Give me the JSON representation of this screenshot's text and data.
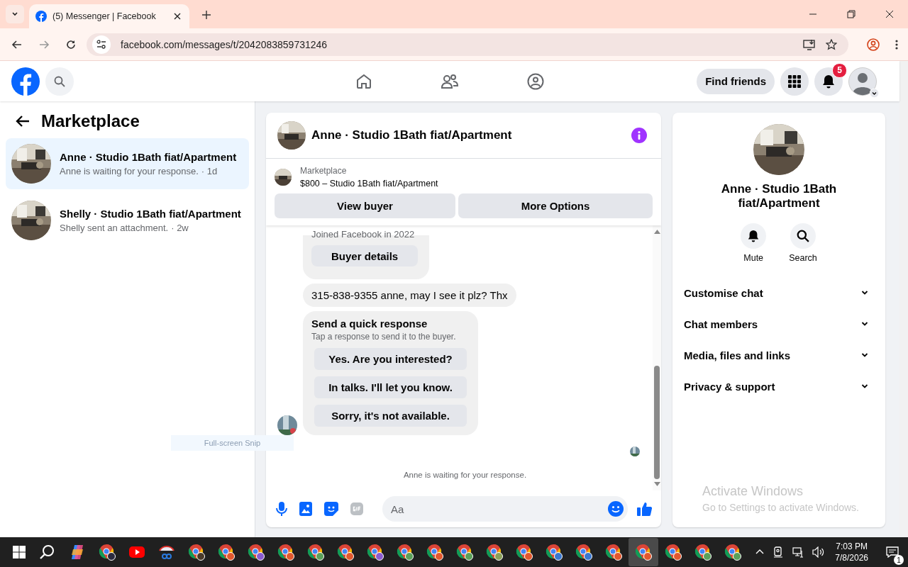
{
  "browser": {
    "tab_title": "(5) Messenger | Facebook",
    "url": "facebook.com/messages/t/2042083859731246"
  },
  "header": {
    "find_friends": "Find friends",
    "notification_count": "5"
  },
  "sidebar": {
    "title": "Marketplace",
    "conversations": [
      {
        "name": "Anne · Studio 1Bath fiat/Apartment",
        "preview": "Anne is waiting for your response.",
        "time": "· 1d",
        "selected": true
      },
      {
        "name": "Shelly · Studio 1Bath fiat/Apartment",
        "preview": "Shelly sent an attachment.",
        "time": "· 2w",
        "selected": false
      }
    ]
  },
  "chat": {
    "title": "Anne · Studio 1Bath fiat/Apartment",
    "listing": {
      "label": "Marketplace",
      "title": "$800 – Studio 1Bath fiat/Apartment"
    },
    "buttons": [
      "View buyer",
      "More Options"
    ],
    "messages": [
      {
        "kind": "card",
        "text": "Joined Facebook in 2022",
        "button": "Buyer details"
      },
      {
        "kind": "text",
        "text": "315-838-9355 anne, may I see it plz? Thx"
      },
      {
        "kind": "quick",
        "title": "Send a quick response",
        "subtitle": "Tap a response to send it to the buyer.",
        "options": [
          "Yes. Are you interested?",
          "In talks. I'll let you know.",
          "Sorry, it's not available."
        ]
      }
    ],
    "status": "Anne is waiting for your response.",
    "composer": {
      "placeholder": "Aa"
    }
  },
  "info": {
    "name": "Anne · Studio 1Bath fiat/Apartment",
    "actions": [
      {
        "kind": "mute",
        "label": "Mute"
      },
      {
        "kind": "search",
        "label": "Search"
      }
    ],
    "sections": [
      "Customise chat",
      "Chat members",
      "Media, files and links",
      "Privacy & support"
    ]
  },
  "snip_label": "Full-screen Snip",
  "watermark": {
    "title": "Activate Windows",
    "subtitle": "Go to Settings to activate Windows."
  },
  "taskbar": {
    "apps": [
      {
        "kind": "copilot",
        "selected": false
      },
      {
        "kind": "chrome",
        "color": "#2b2b40",
        "selected": false
      },
      {
        "kind": "youtube",
        "selected": false
      },
      {
        "kind": "snip",
        "selected": false
      },
      {
        "kind": "chrome",
        "color": "#4a3a2a",
        "selected": false
      },
      {
        "kind": "chrome",
        "color": "#e2582e",
        "selected": false
      },
      {
        "kind": "chrome",
        "color": "#8a5bd0",
        "selected": false
      },
      {
        "kind": "chrome",
        "color": "#e2582e",
        "selected": false
      },
      {
        "kind": "chrome",
        "color": "#5aa05a",
        "selected": false
      },
      {
        "kind": "chrome",
        "color": "#e2582e",
        "selected": false
      },
      {
        "kind": "chrome",
        "color": "#8a5bd0",
        "selected": false
      },
      {
        "kind": "chrome",
        "color": "#5aa05a",
        "selected": false
      },
      {
        "kind": "chrome",
        "color": "#e2582e",
        "selected": false
      },
      {
        "kind": "chrome",
        "color": "#5aa05a",
        "selected": false
      },
      {
        "kind": "chrome",
        "color": "#8aa05a",
        "selected": false
      },
      {
        "kind": "chrome",
        "color": "#e2582e",
        "selected": false
      },
      {
        "kind": "chrome",
        "color": "#3a78d0",
        "selected": false
      },
      {
        "kind": "chrome",
        "color": "#3a78d0",
        "selected": false
      },
      {
        "kind": "chrome",
        "color": "#e2582e",
        "selected": false
      },
      {
        "kind": "chrome",
        "color": "#e2582e",
        "selected": true
      },
      {
        "kind": "chrome",
        "color": "#e2582e",
        "selected": false
      },
      {
        "kind": "chrome",
        "color": "#5aa05a",
        "selected": false
      },
      {
        "kind": "chrome",
        "color": "#5aa05a",
        "selected": false
      }
    ],
    "time": "7:03 PM",
    "date": "7/8/2026",
    "notification_count": "1"
  }
}
